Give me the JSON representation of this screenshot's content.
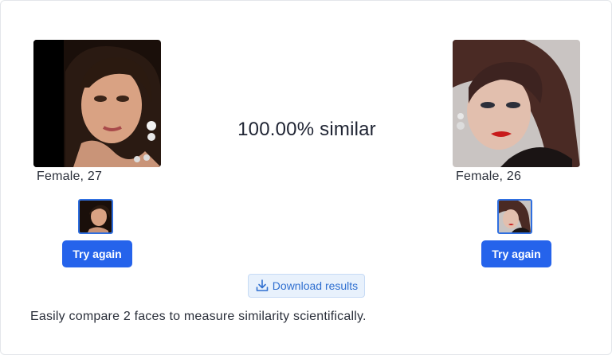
{
  "faces": {
    "left": {
      "label": "Female, 27",
      "photo_icon": "portrait-photo-dark-hair-earring"
    },
    "right": {
      "label": "Female, 26",
      "photo_icon": "portrait-photo-red-lips"
    }
  },
  "result": {
    "similarity_text": "100.00% similar",
    "similarity_percent": 100.0
  },
  "buttons": {
    "try_again_left": "Try again",
    "try_again_right": "Try again",
    "download": "Download results"
  },
  "description": "Easily compare 2 faces to measure similarity scientifically.",
  "colors": {
    "primary": "#2563eb",
    "download_bg": "#e8f1fc",
    "download_text": "#2f6fd0",
    "thumb_border": "#2f6fe0"
  }
}
